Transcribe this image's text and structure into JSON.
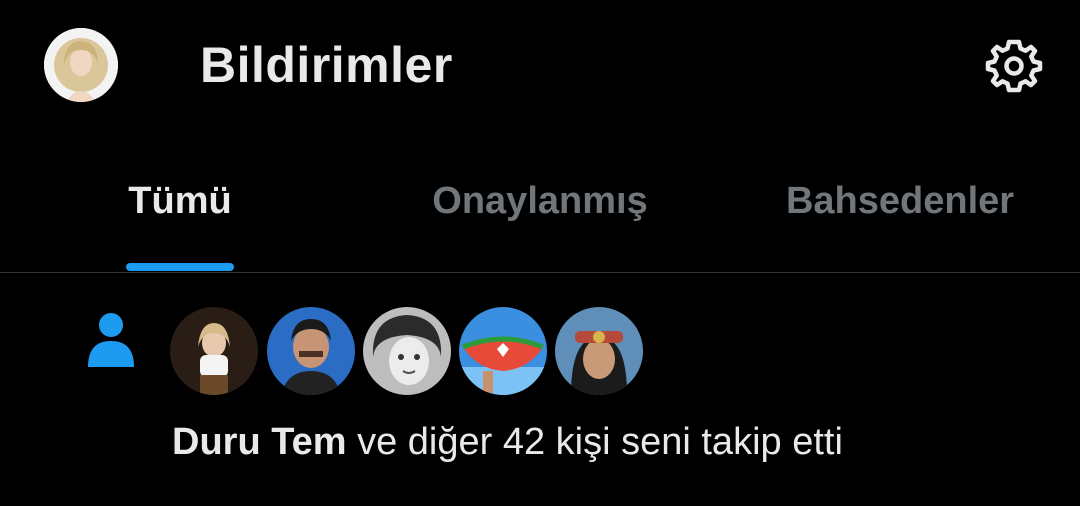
{
  "header": {
    "title": "Bildirimler",
    "avatar_icon": "profile-avatar",
    "settings_icon": "gear-icon"
  },
  "tabs": [
    {
      "label": "Tümü",
      "active": true
    },
    {
      "label": "Onaylanmış",
      "active": false
    },
    {
      "label": "Bahsedenler",
      "active": false
    }
  ],
  "notification": {
    "icon": "person-icon",
    "actor": "Duru Tem",
    "message": " ve diğer 42 kişi seni takip etti"
  },
  "colors": {
    "background": "#000000",
    "accent": "#1d9bf0",
    "text": "#e7e9ea",
    "muted": "#71767b",
    "divider": "#2f3336"
  }
}
